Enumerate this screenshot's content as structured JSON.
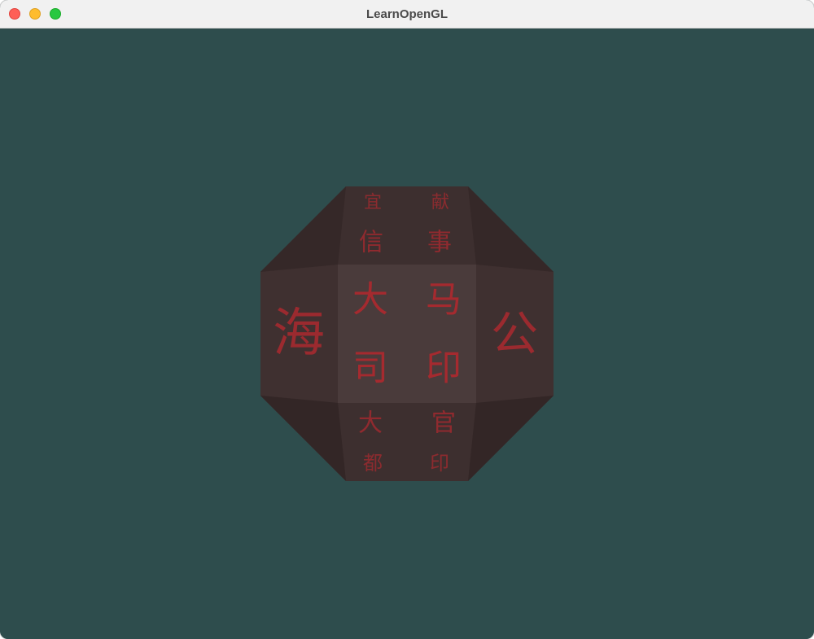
{
  "window": {
    "title": "LearnOpenGL",
    "background_color": "#2e4d4d",
    "controls": [
      "close",
      "minimize",
      "zoom"
    ]
  },
  "scene": {
    "object": "textured cube",
    "texture_color": "#a52a2f",
    "faces": {
      "front": [
        "大",
        "马",
        "司",
        "印"
      ],
      "top": [
        "宜",
        "献",
        "信",
        "事"
      ],
      "bottom": [
        "大",
        "官",
        "都",
        "印"
      ],
      "left": [
        "海"
      ],
      "right": [
        "公"
      ]
    }
  }
}
